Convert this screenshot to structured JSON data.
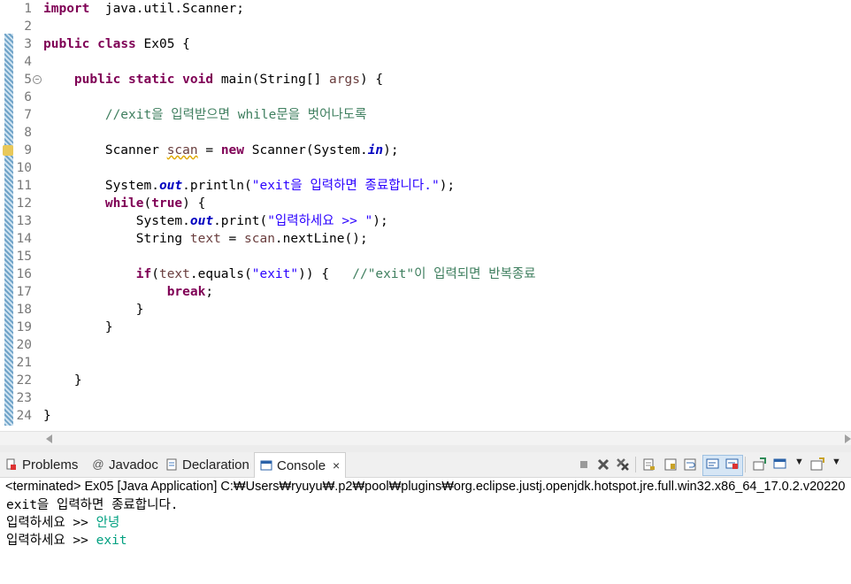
{
  "editor": {
    "lines": [
      {
        "n": "1",
        "segs": [
          [
            "kw",
            "import"
          ],
          [
            "",
            "  java.util.Scanner;"
          ]
        ]
      },
      {
        "n": "2",
        "segs": []
      },
      {
        "n": "3",
        "segs": [
          [
            "kw",
            "public"
          ],
          [
            "",
            " "
          ],
          [
            "kw",
            "class"
          ],
          [
            "",
            " Ex05 {"
          ]
        ]
      },
      {
        "n": "4",
        "segs": []
      },
      {
        "n": "5",
        "fold": true,
        "segs": [
          [
            "",
            "    "
          ],
          [
            "kw",
            "public"
          ],
          [
            "",
            " "
          ],
          [
            "kw",
            "static"
          ],
          [
            "",
            " "
          ],
          [
            "kw",
            "void"
          ],
          [
            "",
            " main(String[] "
          ],
          [
            "var",
            "args"
          ],
          [
            "",
            ") {"
          ]
        ]
      },
      {
        "n": "6",
        "segs": []
      },
      {
        "n": "7",
        "segs": [
          [
            "",
            "        "
          ],
          [
            "cmt",
            "//exit을 입력받으면 while문을 벗어나도록"
          ]
        ]
      },
      {
        "n": "8",
        "segs": []
      },
      {
        "n": "9",
        "warn": true,
        "segs": [
          [
            "",
            "        Scanner "
          ],
          [
            "warn-var",
            "scan"
          ],
          [
            "",
            " = "
          ],
          [
            "kw",
            "new"
          ],
          [
            "",
            " Scanner(System."
          ],
          [
            "fld",
            "in"
          ],
          [
            "",
            ");"
          ]
        ]
      },
      {
        "n": "10",
        "segs": []
      },
      {
        "n": "11",
        "segs": [
          [
            "",
            "        System."
          ],
          [
            "fld",
            "out"
          ],
          [
            "",
            ".println("
          ],
          [
            "str",
            "\"exit을 입력하면 종료합니다.\""
          ],
          [
            "",
            ");"
          ]
        ]
      },
      {
        "n": "12",
        "segs": [
          [
            "",
            "        "
          ],
          [
            "kw",
            "while"
          ],
          [
            "",
            "("
          ],
          [
            "kw",
            "true"
          ],
          [
            "",
            ") {"
          ]
        ]
      },
      {
        "n": "13",
        "segs": [
          [
            "",
            "            System."
          ],
          [
            "fld",
            "out"
          ],
          [
            "",
            ".print("
          ],
          [
            "str",
            "\"입력하세요 >> \""
          ],
          [
            "",
            ");"
          ]
        ]
      },
      {
        "n": "14",
        "segs": [
          [
            "",
            "            String "
          ],
          [
            "var",
            "text"
          ],
          [
            "",
            " = "
          ],
          [
            "var",
            "scan"
          ],
          [
            "",
            ".nextLine();"
          ]
        ]
      },
      {
        "n": "15",
        "segs": []
      },
      {
        "n": "16",
        "segs": [
          [
            "",
            "            "
          ],
          [
            "kw",
            "if"
          ],
          [
            "",
            "("
          ],
          [
            "var",
            "text"
          ],
          [
            "",
            ".equals("
          ],
          [
            "str",
            "\"exit\""
          ],
          [
            "",
            ")) {   "
          ],
          [
            "cmt",
            "//\"exit\"이 입력되면 반복종료"
          ]
        ]
      },
      {
        "n": "17",
        "segs": [
          [
            "",
            "                "
          ],
          [
            "kw",
            "break"
          ],
          [
            "",
            ";"
          ]
        ]
      },
      {
        "n": "18",
        "segs": [
          [
            "",
            "            }"
          ]
        ]
      },
      {
        "n": "19",
        "segs": [
          [
            "",
            "        }"
          ]
        ]
      },
      {
        "n": "20",
        "segs": []
      },
      {
        "n": "21",
        "segs": []
      },
      {
        "n": "22",
        "segs": [
          [
            "",
            "    }"
          ]
        ]
      },
      {
        "n": "23",
        "segs": []
      },
      {
        "n": "24",
        "segs": [
          [
            "",
            "}"
          ]
        ]
      }
    ]
  },
  "tabs": {
    "problems": "Problems",
    "javadoc": "Javadoc",
    "declaration": "Declaration",
    "console": "Console",
    "close": "×"
  },
  "console": {
    "header": "<terminated> Ex05 [Java Application] C:₩Users₩ryuyu₩.p2₩pool₩plugins₩org.eclipse.justj.openjdk.hotspot.jre.full.win32.x86_64_17.0.2.v20220",
    "lines": [
      {
        "prompt": "exit을 입력하면 종료합니다.",
        "input": ""
      },
      {
        "prompt": "입력하세요 >> ",
        "input": "안녕"
      },
      {
        "prompt": "입력하세요 >> ",
        "input": "exit"
      }
    ]
  },
  "colors": {
    "keyword": "#7f0055",
    "string": "#2a00ff",
    "comment": "#3f7f5f",
    "field": "#0000c0",
    "console_input": "#00a080"
  }
}
